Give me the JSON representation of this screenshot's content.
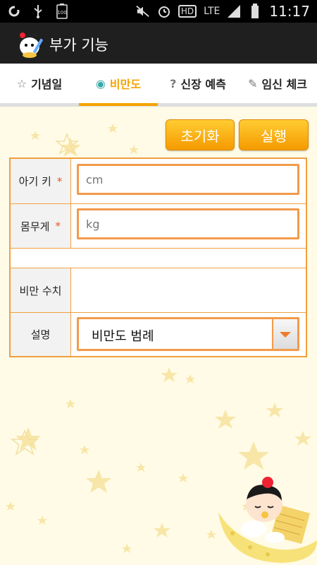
{
  "status_bar": {
    "time": "11:17",
    "battery_small": "100",
    "hd": "HD",
    "lte": "LTE"
  },
  "app": {
    "title": "부가 기능"
  },
  "tabs": [
    {
      "label": "기념일",
      "icon": "star-icon",
      "active": false
    },
    {
      "label": "비만도",
      "icon": "scale-icon",
      "active": true
    },
    {
      "label": "신장 예측",
      "icon": "question-icon",
      "active": false
    },
    {
      "label": "임신 체크",
      "icon": "pencil-icon",
      "active": false
    }
  ],
  "buttons": {
    "reset": "초기화",
    "run": "실행"
  },
  "form": {
    "height": {
      "label": "아기 키",
      "required_mark": "*",
      "placeholder": "cm"
    },
    "weight": {
      "label": "몸무게",
      "required_mark": "*",
      "placeholder": "kg"
    },
    "obesity_value": {
      "label": "비만 수치",
      "value": ""
    },
    "description": {
      "label": "설명",
      "selected": "비만도 범례"
    }
  },
  "colors": {
    "accent": "#f5a400",
    "input_border": "#f39a4a",
    "form_border": "#f0a040",
    "background": "#fffbe6"
  }
}
